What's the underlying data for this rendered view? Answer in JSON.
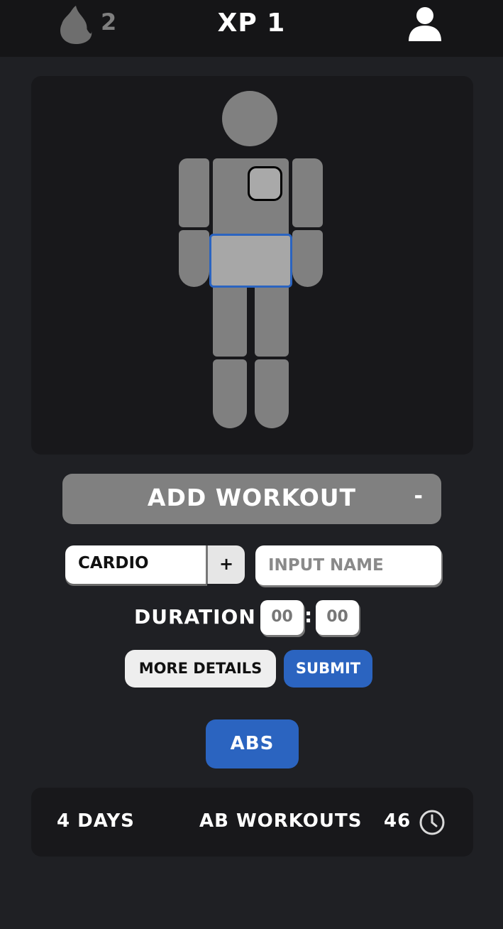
{
  "header": {
    "streak_icon": "flame-icon",
    "streak_count": "2",
    "xp_label": "XP 1",
    "profile_icon": "user-icon"
  },
  "body_map": {
    "selected_part": "abs",
    "highlight_color": "#2b64c0"
  },
  "add_workout": {
    "title": "ADD WORKOUT",
    "toggle_label": "-"
  },
  "form": {
    "workout_type": "CARDIO",
    "add_type_label": "+",
    "name_placeholder": "INPUT NAME",
    "name_value": "",
    "duration_label": "DURATION",
    "duration_minutes": "00",
    "duration_separator": ":",
    "duration_seconds": "00",
    "more_details_label": "MORE DETAILS",
    "submit_label": "SUBMIT"
  },
  "category": {
    "label": "ABS"
  },
  "stats": {
    "days": "4 DAYS",
    "title": "AB WORKOUTS",
    "count": "46",
    "clock_icon": "clock-icon"
  },
  "colors": {
    "background": "#1f2024",
    "panel": "#18181b",
    "accent": "#2b64c0",
    "muted": "#808080"
  }
}
